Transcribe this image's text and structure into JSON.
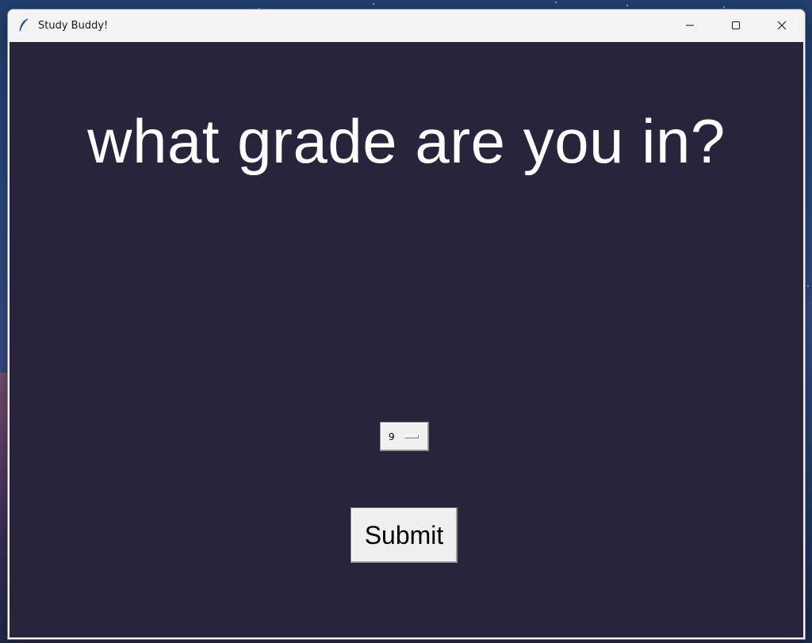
{
  "window": {
    "title": "Study Buddy!",
    "icon": "feather-icon",
    "controls": [
      "minimize-icon",
      "maximize-icon",
      "close-icon"
    ]
  },
  "main": {
    "question": "what grade are you in?",
    "grade_select": {
      "selected_value": "9"
    },
    "submit_label": "Submit"
  },
  "colors": {
    "client_background": "#29233b",
    "question_text": "#ffffff",
    "button_face": "#f0f0f0",
    "titlebar": "#f3f3f3"
  }
}
